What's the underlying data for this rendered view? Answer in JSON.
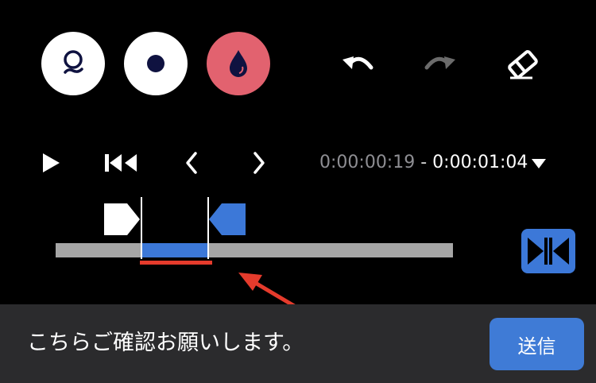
{
  "tools": {
    "lasso": {
      "icon": "lasso-icon",
      "background": "#ffffff"
    },
    "dot": {
      "icon": "dot-icon",
      "background": "#ffffff"
    },
    "drop": {
      "icon": "drop-icon",
      "background": "#e2626f"
    }
  },
  "toolbar": {
    "undo_icon": "undo-icon",
    "redo_icon": "redo-icon",
    "eraser_icon": "eraser-icon"
  },
  "playback": {
    "play_icon": "play-icon",
    "skip_start_icon": "skip-to-start-icon",
    "prev_icon": "chevron-left-icon",
    "next_icon": "chevron-right-icon",
    "time_start": "0:00:00:19",
    "time_separator": " - ",
    "time_end": "0:00:01:04",
    "dropdown_icon": "dropdown-triangle-icon"
  },
  "timeline": {
    "selection_start_fraction": 0.216,
    "selection_end_fraction": 0.384,
    "track_color": "#a6a6a6",
    "selection_color": "#3c78d8",
    "underline_color": "#e53b2c",
    "fit_icon": "fit-selection-icon"
  },
  "colors": {
    "accent": "#3c78d8",
    "drop_tool": "#e2626f",
    "annotation": "#e53b2c",
    "tool_icon": "#0f1240"
  },
  "footer": {
    "message": "こちらご確認お願いします。",
    "send_label": "送信"
  }
}
